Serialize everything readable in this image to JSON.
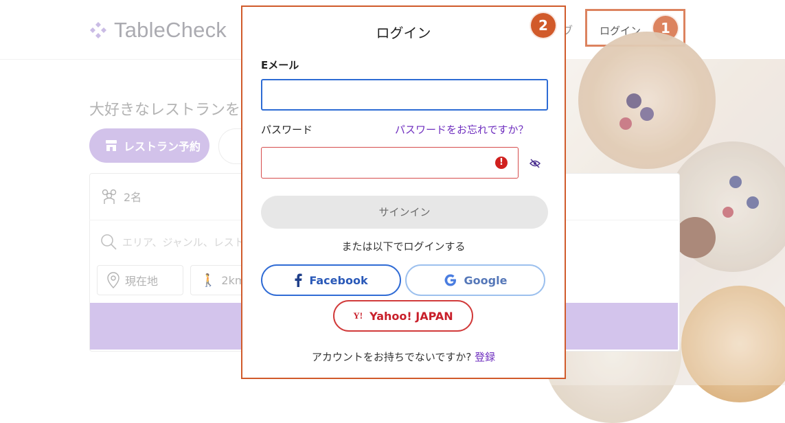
{
  "header": {
    "brand": "TableCheck",
    "nav_tail": "ブ",
    "login_label": "ログイン"
  },
  "annotations": {
    "step1": "1",
    "step2": "2"
  },
  "page": {
    "tagline": "大好きなレストランを食",
    "tab_reserve": "レストラン予約",
    "guests": "2名",
    "search_placeholder": "エリア、ジャンル、レストラン",
    "chip_location": "現在地",
    "chip_distance": "2km"
  },
  "modal": {
    "title": "ログイン",
    "email_label": "Eメール",
    "password_label": "パスワード",
    "forgot_link": "パスワードをお忘れですか？",
    "signin_button": "サインイン",
    "or_text": "または以下でログインする",
    "facebook_label": "Facebook",
    "google_label": "Google",
    "yahoo_label": "Yahoo! JAPAN",
    "no_account_text": "アカウントをお持ちでないですか?",
    "register_link": "登録"
  },
  "colors": {
    "accent": "#c3aee3",
    "annotation": "#d15a2a",
    "focus": "#2d6bd4",
    "error": "#d64b4b",
    "link": "#6f2fbf"
  }
}
